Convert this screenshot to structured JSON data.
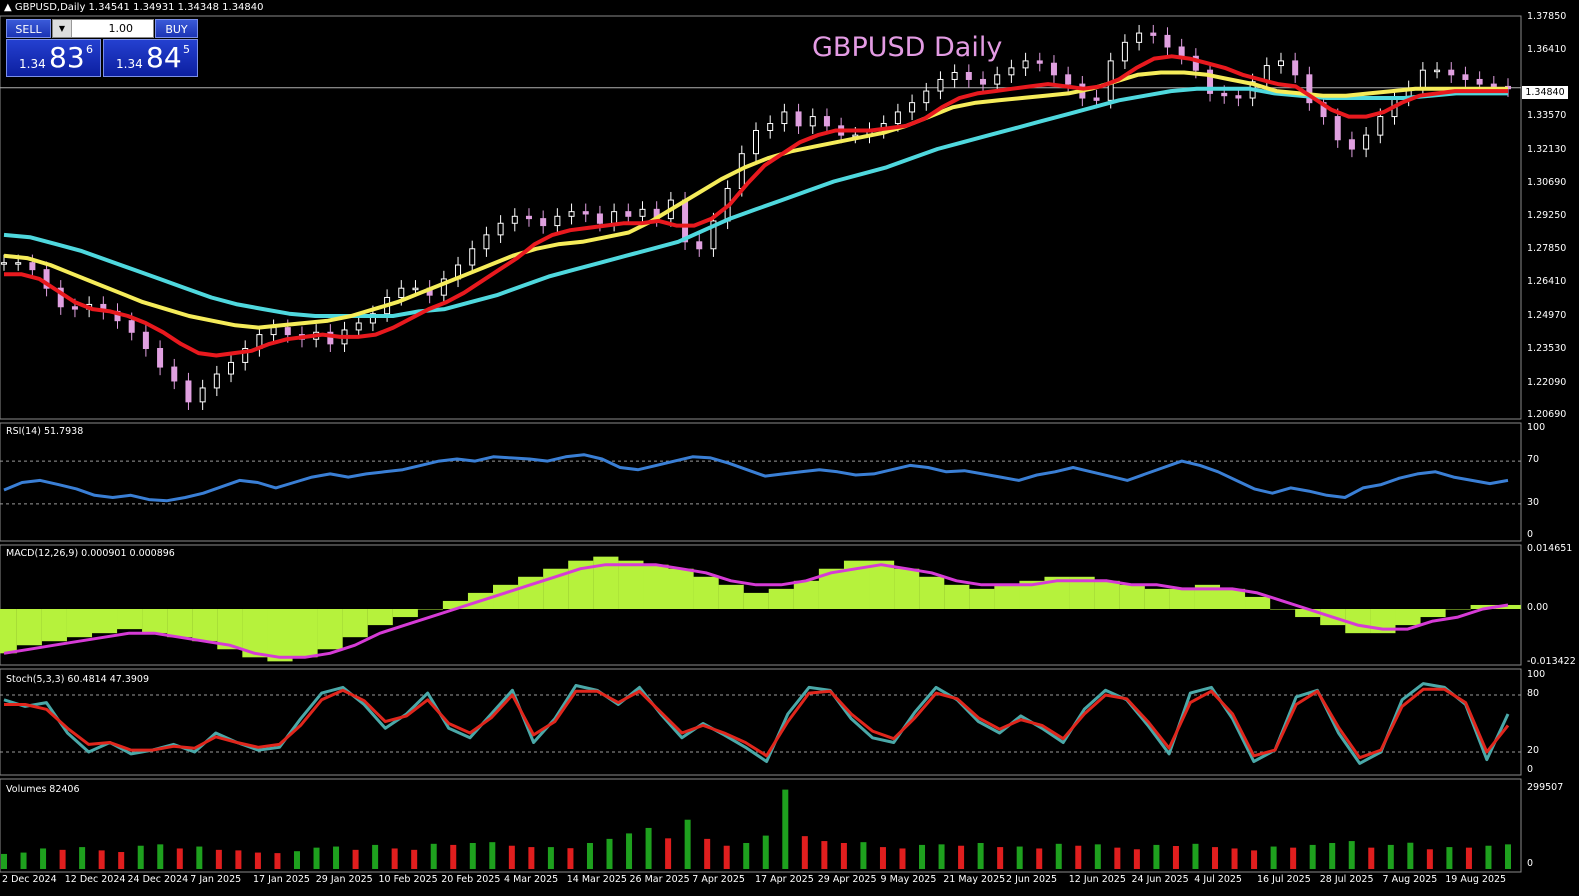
{
  "header": {
    "symbol_line": "GBPUSD,Daily  1.34541 1.34931 1.34348 1.34840"
  },
  "chart_title": "GBPUSD Daily",
  "trade_panel": {
    "sell_label": "SELL",
    "buy_label": "BUY",
    "lot_size": "1.00",
    "sell_prefix": "1.34",
    "sell_big": "83",
    "sell_sup": "6",
    "buy_prefix": "1.34",
    "buy_big": "84",
    "buy_sup": "5"
  },
  "current_price_tag": "1.34840",
  "price_axis": [
    "1.37850",
    "1.36410",
    "1.34840",
    "1.33570",
    "1.32130",
    "1.30690",
    "1.29250",
    "1.27850",
    "1.26410",
    "1.24970",
    "1.23530",
    "1.22090",
    "1.20690"
  ],
  "indicators": {
    "rsi_label": "RSI(14) 51.7938",
    "rsi_axis": [
      "100",
      "70",
      "30",
      "0"
    ],
    "macd_label": "MACD(12,26,9) 0.000901 0.000896",
    "macd_axis": [
      "0.014651",
      "0.00",
      "-0.013422"
    ],
    "stoch_label": "Stoch(5,3,3) 60.4814 47.3909",
    "stoch_axis": [
      "100",
      "80",
      "20",
      "0"
    ],
    "volume_label": "Volumes 82406",
    "volume_axis": [
      "299507",
      "0"
    ]
  },
  "date_axis": [
    "2 Dec 2024",
    "12 Dec 2024",
    "24 Dec 2024",
    "7 Jan 2025",
    "17 Jan 2025",
    "29 Jan 2025",
    "10 Feb 2025",
    "20 Feb 2025",
    "4 Mar 2025",
    "14 Mar 2025",
    "26 Mar 2025",
    "7 Apr 2025",
    "17 Apr 2025",
    "29 Apr 2025",
    "9 May 2025",
    "21 May 2025",
    "2 Jun 2025",
    "12 Jun 2025",
    "24 Jun 2025",
    "4 Jul 2025",
    "16 Jul 2025",
    "28 Jul 2025",
    "7 Aug 2025",
    "19 Aug 2025"
  ],
  "colors": {
    "candle_up": "#ffffff",
    "candle_down": "#e0a0e0",
    "ma_fast": "#e8191e",
    "ma_mid": "#f5ec5a",
    "ma_slow": "#4fd8de",
    "rsi_line": "#3a7fd5",
    "macd_hist": "#b6f23c",
    "macd_signal": "#d63bd6",
    "stoch_main": "#4aa8a8",
    "stoch_signal": "#e0261c",
    "vol_up": "#1ea01e",
    "vol_down": "#e01e1e"
  },
  "chart_data": {
    "type": "line",
    "title": "GBPUSD Daily",
    "x_range": [
      "2 Dec 2024",
      "22 Aug 2025"
    ],
    "ylim": [
      1.2069,
      1.3785
    ],
    "series": [
      {
        "name": "Close",
        "values": [
          1.273,
          1.273,
          1.27,
          1.262,
          1.254,
          1.253,
          1.255,
          1.252,
          1.248,
          1.243,
          1.236,
          1.228,
          1.222,
          1.213,
          1.219,
          1.225,
          1.23,
          1.236,
          1.242,
          1.245,
          1.242,
          1.24,
          1.243,
          1.238,
          1.244,
          1.247,
          1.251,
          1.258,
          1.262,
          1.262,
          1.259,
          1.266,
          1.272,
          1.279,
          1.285,
          1.29,
          1.293,
          1.292,
          1.289,
          1.293,
          1.295,
          1.294,
          1.29,
          1.295,
          1.293,
          1.296,
          1.292,
          1.3,
          1.282,
          1.279,
          1.291,
          1.305,
          1.32,
          1.33,
          1.333,
          1.338,
          1.332,
          1.336,
          1.332,
          1.328,
          1.328,
          1.33,
          1.333,
          1.338,
          1.342,
          1.347,
          1.352,
          1.355,
          1.352,
          1.35,
          1.354,
          1.357,
          1.36,
          1.359,
          1.354,
          1.35,
          1.344,
          1.343,
          1.36,
          1.368,
          1.372,
          1.371,
          1.366,
          1.362,
          1.356,
          1.346,
          1.345,
          1.344,
          1.351,
          1.358,
          1.36,
          1.354,
          1.342,
          1.336,
          1.326,
          1.322,
          1.328,
          1.336,
          1.344,
          1.348,
          1.356,
          1.356,
          1.354,
          1.352,
          1.35,
          1.349,
          1.348
        ]
      },
      {
        "name": "",
        "values": [
          1.268,
          1.268,
          1.266,
          1.261,
          1.256,
          1.253,
          1.252,
          1.25,
          1.247,
          1.243,
          1.238,
          1.234,
          1.233,
          1.234,
          1.235,
          1.238,
          1.24,
          1.241,
          1.242,
          1.241,
          1.241,
          1.242,
          1.245,
          1.249,
          1.253,
          1.256,
          1.26,
          1.265,
          1.27,
          1.275,
          1.281,
          1.285,
          1.287,
          1.288,
          1.289,
          1.29,
          1.29,
          1.291,
          1.289,
          1.289,
          1.292,
          1.298,
          1.307,
          1.315,
          1.32,
          1.325,
          1.328,
          1.33,
          1.33,
          1.33,
          1.331,
          1.332,
          1.335,
          1.34,
          1.344,
          1.346,
          1.347,
          1.348,
          1.349,
          1.35,
          1.349,
          1.348,
          1.349,
          1.352,
          1.357,
          1.361,
          1.362,
          1.361,
          1.359,
          1.357,
          1.354,
          1.352,
          1.35,
          1.349,
          1.344,
          1.339,
          1.336,
          1.336,
          1.338,
          1.342,
          1.345,
          1.346,
          1.347,
          1.347,
          1.347,
          1.347
        ]
      },
      {
        "name": "",
        "values": [
          1.276,
          1.275,
          1.272,
          1.268,
          1.264,
          1.26,
          1.256,
          1.253,
          1.25,
          1.248,
          1.246,
          1.245,
          1.246,
          1.247,
          1.248,
          1.25,
          1.253,
          1.256,
          1.26,
          1.264,
          1.268,
          1.272,
          1.276,
          1.279,
          1.281,
          1.282,
          1.284,
          1.286,
          1.291,
          1.297,
          1.303,
          1.309,
          1.314,
          1.318,
          1.321,
          1.323,
          1.325,
          1.327,
          1.329,
          1.332,
          1.336,
          1.34,
          1.342,
          1.343,
          1.344,
          1.345,
          1.346,
          1.348,
          1.351,
          1.354,
          1.355,
          1.355,
          1.354,
          1.352,
          1.35,
          1.347,
          1.346,
          1.345,
          1.345,
          1.346,
          1.347,
          1.348,
          1.348,
          1.348,
          1.348,
          1.348
        ]
      },
      {
        "name": "",
        "values": [
          1.285,
          1.284,
          1.281,
          1.278,
          1.274,
          1.27,
          1.266,
          1.262,
          1.258,
          1.255,
          1.253,
          1.251,
          1.25,
          1.25,
          1.25,
          1.25,
          1.252,
          1.253,
          1.256,
          1.259,
          1.263,
          1.267,
          1.27,
          1.273,
          1.276,
          1.279,
          1.282,
          1.287,
          1.292,
          1.296,
          1.3,
          1.304,
          1.308,
          1.311,
          1.314,
          1.318,
          1.322,
          1.325,
          1.328,
          1.331,
          1.334,
          1.337,
          1.34,
          1.343,
          1.345,
          1.347,
          1.348,
          1.348,
          1.348,
          1.346,
          1.345,
          1.344,
          1.344,
          1.344,
          1.344,
          1.345,
          1.346,
          1.346,
          1.346
        ]
      },
      {
        "name": "",
        "values": [
          43,
          50,
          52,
          48,
          44,
          38,
          36,
          38,
          34,
          33,
          36,
          40,
          46,
          52,
          50,
          45,
          50,
          55,
          58,
          55,
          58,
          60,
          62,
          66,
          70,
          72,
          70,
          74,
          73,
          72,
          70,
          74,
          76,
          72,
          64,
          62,
          66,
          70,
          74,
          73,
          68,
          62,
          56,
          58,
          60,
          62,
          60,
          57,
          58,
          62,
          66,
          64,
          60,
          61,
          58,
          55,
          52,
          57,
          60,
          64,
          60,
          56,
          52,
          58,
          64,
          70,
          66,
          60,
          52,
          44,
          40,
          45,
          42,
          38,
          36,
          45,
          48,
          54,
          58,
          60,
          55,
          52,
          49,
          52
        ]
      },
      {
        "name": "",
        "values": [
          -0.011,
          -0.009,
          -0.008,
          -0.007,
          -0.006,
          -0.005,
          -0.006,
          -0.007,
          -0.008,
          -0.01,
          -0.012,
          -0.013,
          -0.012,
          -0.01,
          -0.007,
          -0.004,
          -0.002,
          0.0,
          0.002,
          0.004,
          0.006,
          0.008,
          0.01,
          0.012,
          0.013,
          0.012,
          0.011,
          0.01,
          0.008,
          0.006,
          0.004,
          0.005,
          0.007,
          0.01,
          0.012,
          0.012,
          0.01,
          0.008,
          0.006,
          0.005,
          0.006,
          0.007,
          0.008,
          0.008,
          0.007,
          0.006,
          0.005,
          0.005,
          0.006,
          0.005,
          0.003,
          0.0,
          -0.002,
          -0.004,
          -0.006,
          -0.006,
          -0.004,
          -0.002,
          0.0,
          0.001,
          0.001
        ]
      },
      {
        "name": "",
        "values": [
          -0.011,
          -0.01,
          -0.009,
          -0.008,
          -0.007,
          -0.006,
          -0.006,
          -0.007,
          -0.008,
          -0.009,
          -0.011,
          -0.012,
          -0.012,
          -0.011,
          -0.009,
          -0.006,
          -0.004,
          -0.002,
          0.0,
          0.002,
          0.004,
          0.006,
          0.008,
          0.01,
          0.011,
          0.011,
          0.011,
          0.01,
          0.009,
          0.007,
          0.006,
          0.006,
          0.007,
          0.009,
          0.01,
          0.011,
          0.01,
          0.009,
          0.007,
          0.006,
          0.006,
          0.006,
          0.007,
          0.007,
          0.007,
          0.006,
          0.006,
          0.005,
          0.005,
          0.005,
          0.004,
          0.002,
          0.0,
          -0.002,
          -0.004,
          -0.005,
          -0.005,
          -0.003,
          -0.002,
          0.0,
          0.001
        ]
      },
      {
        "name": "",
        "values": [
          75,
          68,
          72,
          40,
          20,
          30,
          18,
          22,
          28,
          20,
          40,
          30,
          22,
          25,
          55,
          82,
          88,
          70,
          45,
          60,
          82,
          45,
          35,
          60,
          85,
          30,
          55,
          90,
          85,
          70,
          88,
          60,
          35,
          50,
          38,
          25,
          10,
          60,
          88,
          85,
          55,
          35,
          30,
          62,
          88,
          75,
          52,
          40,
          58,
          45,
          30,
          65,
          85,
          75,
          48,
          18,
          82,
          88,
          55,
          10,
          22,
          78,
          85,
          40,
          8,
          20,
          75,
          92,
          88,
          70,
          12,
          60
        ]
      },
      {
        "name": "",
        "values": [
          70,
          70,
          65,
          45,
          28,
          30,
          22,
          22,
          26,
          24,
          36,
          30,
          25,
          28,
          48,
          75,
          85,
          74,
          52,
          58,
          75,
          50,
          40,
          56,
          80,
          38,
          52,
          84,
          84,
          72,
          84,
          62,
          40,
          48,
          40,
          30,
          16,
          52,
          82,
          84,
          60,
          42,
          34,
          56,
          82,
          76,
          56,
          44,
          54,
          48,
          34,
          60,
          80,
          76,
          52,
          24,
          72,
          84,
          60,
          16,
          22,
          70,
          84,
          46,
          14,
          22,
          68,
          86,
          86,
          72,
          20,
          48
        ]
      },
      {
        "name": "",
        "values": [
          55,
          60,
          75,
          70,
          80,
          68,
          62,
          85,
          90,
          75,
          82,
          70,
          68,
          60,
          58,
          65,
          78,
          82,
          70,
          88,
          75,
          70,
          92,
          88,
          95,
          98,
          85,
          80,
          80,
          76,
          95,
          110,
          130,
          150,
          112,
          180,
          110,
          85,
          95,
          122,
          290,
          120,
          102,
          95,
          98,
          80,
          75,
          88,
          90,
          85,
          95,
          80,
          82,
          75,
          92,
          85,
          90,
          78,
          72,
          88,
          84,
          92,
          80,
          75,
          68,
          82,
          78,
          88,
          95,
          102,
          78,
          88,
          96,
          72,
          80,
          78,
          85,
          90
        ]
      }
    ]
  }
}
